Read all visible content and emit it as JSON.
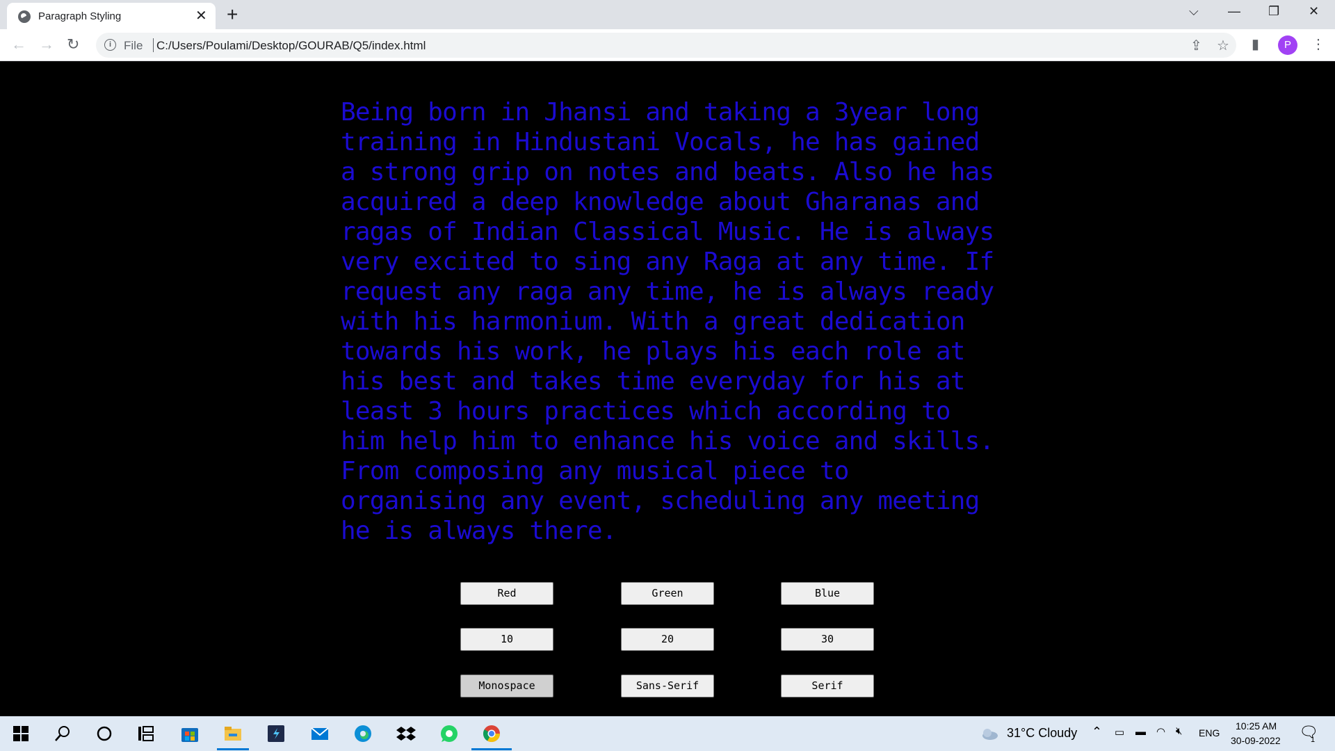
{
  "browser": {
    "tab_title": "Paragraph Styling",
    "url_scheme": "File",
    "url": "C:/Users/Poulami/Desktop/GOURAB/Q5/index.html",
    "avatar_letter": "P"
  },
  "page": {
    "paragraph": "Being born in Jhansi and taking a 3year long training in Hindustani Vocals, he has gained a strong grip on notes and beats. Also he has acquired a deep knowledge about Gharanas and ragas of Indian Classical Music. He is always very excited to sing any Raga at any time. If request any raga any time, he is always ready with his harmonium. With a great dedication towards his work, he plays his each role at his best and takes time everyday for his at least 3 hours practices which according to him help him to enhance his voice and skills. From composing any musical piece to organising any event, scheduling any meeting he is always there.",
    "paragraph_color": "#1b0bd1",
    "buttons": {
      "red": "Red",
      "green": "Green",
      "blue": "Blue",
      "size10": "10",
      "size20": "20",
      "size30": "30",
      "monospace": "Monospace",
      "sans_serif": "Sans-Serif",
      "serif": "Serif"
    }
  },
  "taskbar": {
    "weather": "31°C  Cloudy",
    "language": "ENG",
    "time": "10:25 AM",
    "date": "30-09-2022",
    "notification_count": "1"
  }
}
